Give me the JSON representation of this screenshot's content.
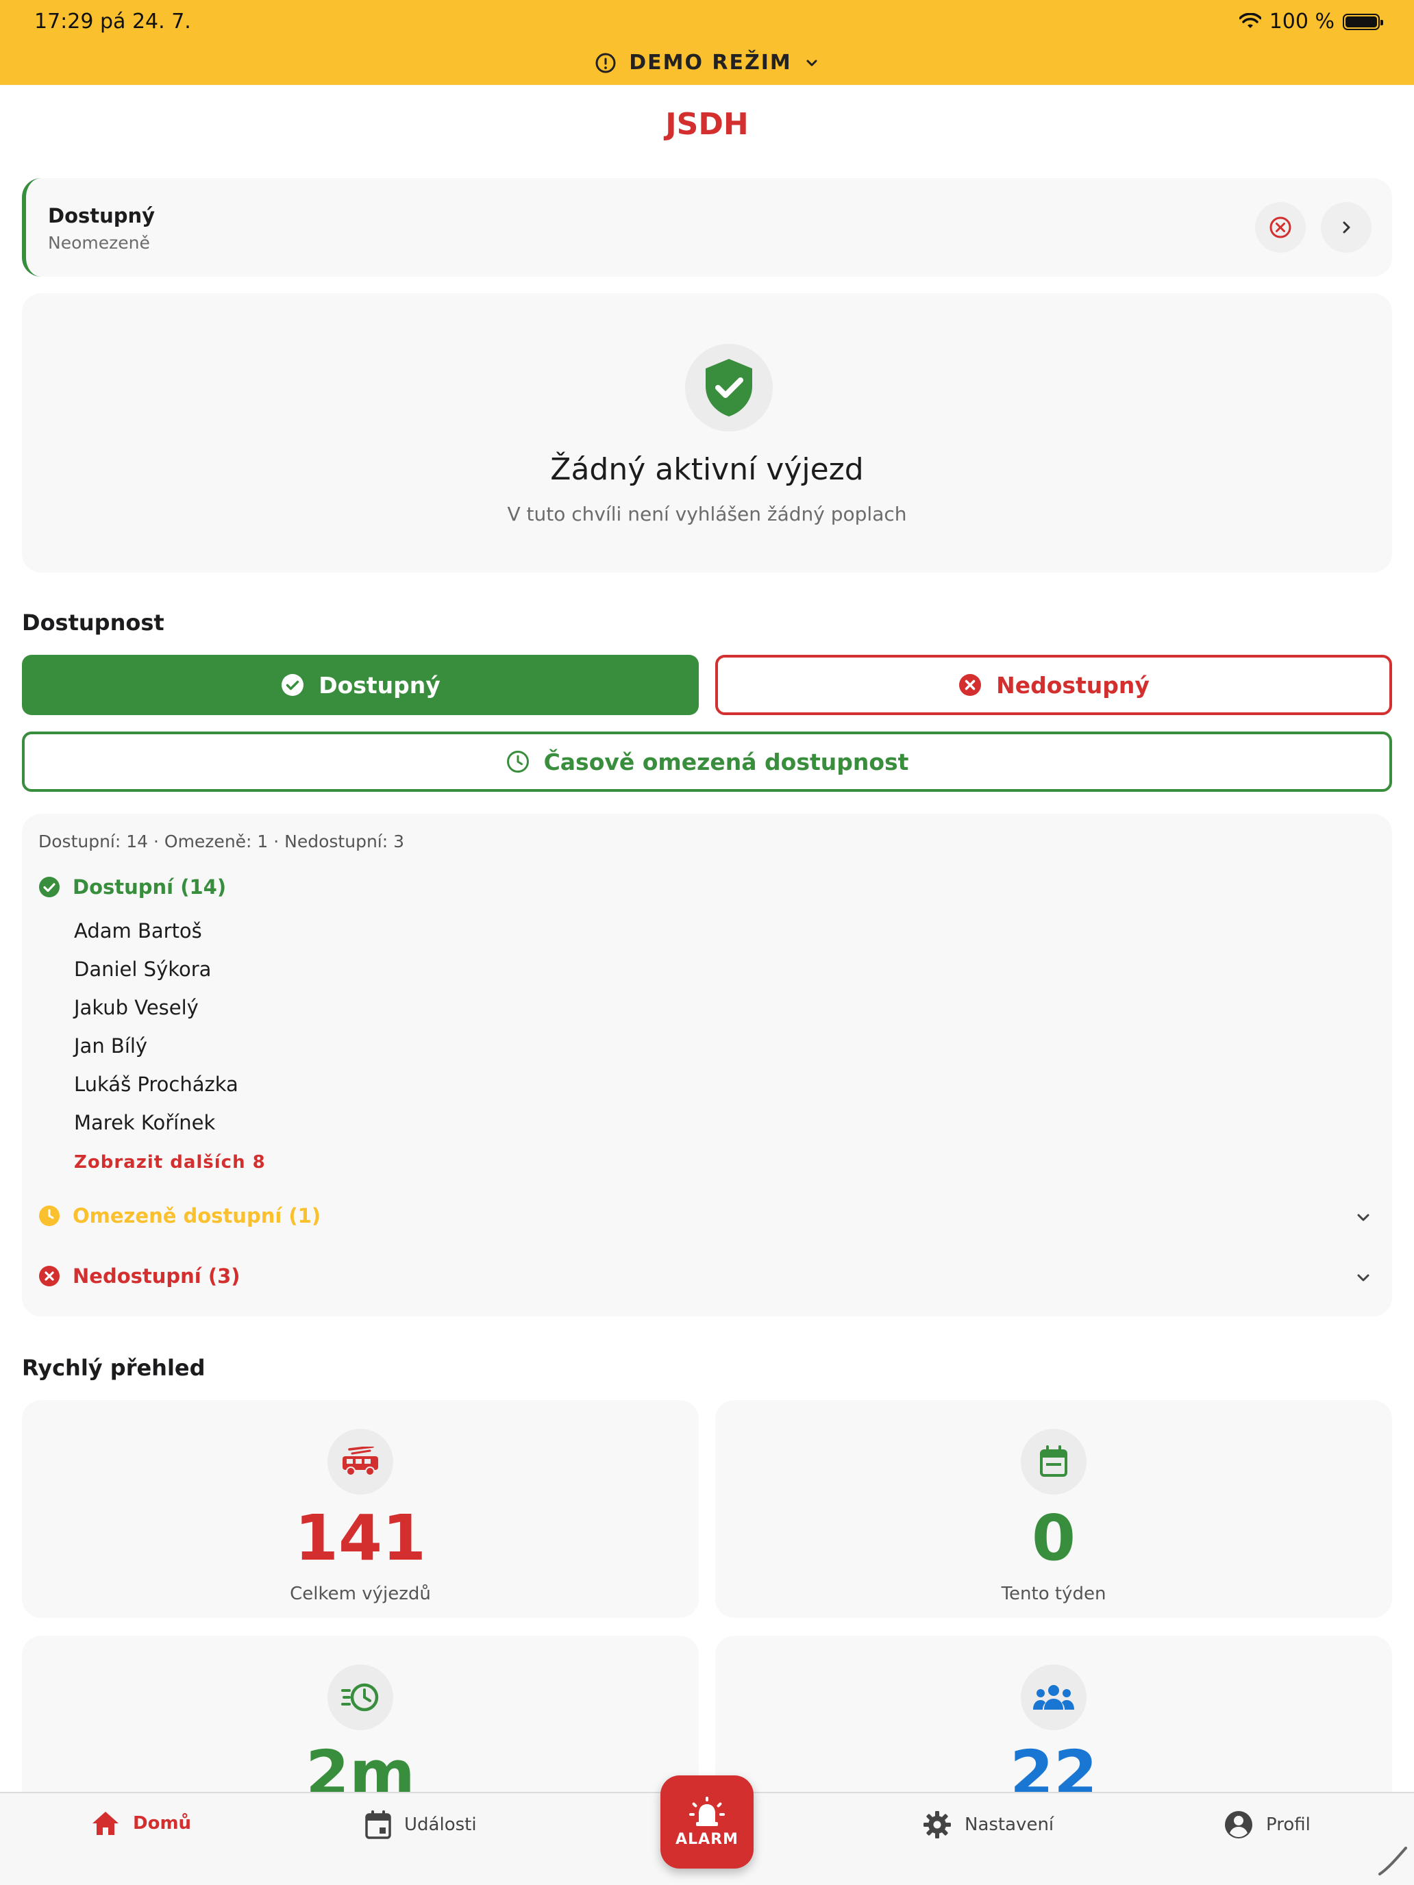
{
  "status_bar": {
    "time": "17:29  pá 24. 7.",
    "battery_text": "100 %"
  },
  "demo_mode": {
    "label": "DEMO REŽIM"
  },
  "app": {
    "title": "JSDH"
  },
  "current_status": {
    "title": "Dostupný",
    "subtitle": "Neomezeně"
  },
  "active_incident": {
    "title": "Žádný aktivní výjezd",
    "subtitle": "V tuto chvíli není vyhlášen žádný poplach"
  },
  "availability": {
    "heading": "Dostupnost",
    "available_label": "Dostupný",
    "unavailable_label": "Nedostupný",
    "timed_label": "Časově omezená dostupnost"
  },
  "members": {
    "summary": "Dostupní: 14 · Omezeně: 1 · Nedostupní: 3",
    "available_group": "Dostupní (14)",
    "available_list": [
      "Adam Bartoš",
      "Daniel Sýkora",
      "Jakub Veselý",
      "Jan Bílý",
      "Lukáš Procházka",
      "Marek Kořínek"
    ],
    "show_more": "Zobrazit dalších 8",
    "limited_group": "Omezeně dostupní (1)",
    "unavailable_group": "Nedostupní (3)"
  },
  "overview": {
    "heading": "Rychlý přehled",
    "stats": [
      {
        "value": "141",
        "label": "Celkem výjezdů",
        "color": "#d32f2f",
        "icon": "fire-truck-icon"
      },
      {
        "value": "0",
        "label": "Tento týden",
        "color": "#388e3c",
        "icon": "calendar-icon"
      },
      {
        "value": "2m",
        "label": "",
        "color": "#388e3c",
        "icon": "fast-clock-icon"
      },
      {
        "value": "22",
        "label": "",
        "color": "#1976d2",
        "icon": "group-icon"
      }
    ]
  },
  "nav": {
    "home": "Domů",
    "events": "Události",
    "alarm": "ALARM",
    "settings": "Nastavení",
    "profile": "Profil"
  },
  "colors": {
    "primary": "#d32f2f",
    "success": "#388e3c",
    "warning": "#fbc02d",
    "info": "#1976d2"
  }
}
